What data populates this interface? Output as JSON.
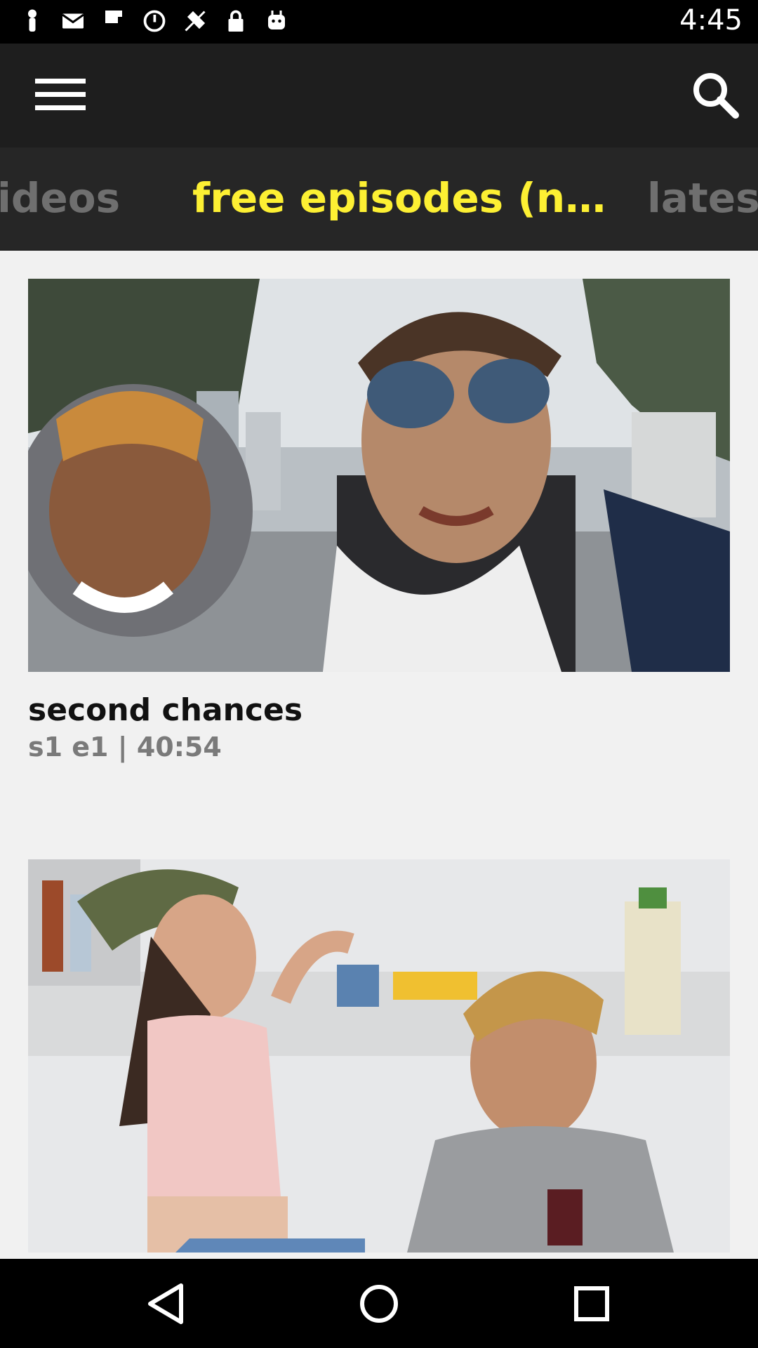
{
  "status_bar": {
    "time": "4:45",
    "icons": [
      "notification-icon",
      "mail-icon",
      "flipboard-icon",
      "sync-icon",
      "fake-gps-icon",
      "lock-icon",
      "android-icon"
    ]
  },
  "app_bar": {
    "menu_icon": "hamburger-menu-icon",
    "search_icon": "search-icon"
  },
  "tabs": [
    {
      "label": "ideos",
      "active": false
    },
    {
      "label": "free episodes (n…",
      "active": true
    },
    {
      "label": "latest",
      "active": false
    }
  ],
  "episodes": [
    {
      "title": "second chances",
      "meta": "s1 e1 | 40:54"
    }
  ],
  "nav_bar": {
    "back_icon": "back-triangle-icon",
    "home_icon": "home-circle-icon",
    "recents_icon": "recents-square-icon"
  },
  "colors": {
    "active_tab": "#fdf033",
    "inactive_tab": "#6f6f6f",
    "app_bar": "#1e1e1e",
    "tab_strip": "#262626",
    "background": "#f1f1f1"
  }
}
